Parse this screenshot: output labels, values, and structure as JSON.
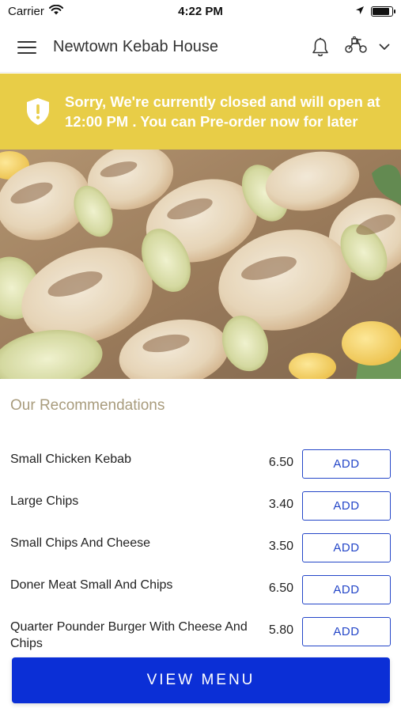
{
  "status_bar": {
    "carrier": "Carrier",
    "time": "4:22 PM",
    "battery_level": 0.9
  },
  "header": {
    "title": "Newtown Kebab House",
    "menu_icon": "hamburger-menu-icon",
    "notification_icon": "bell-icon",
    "delivery_icon": "scooter-icon",
    "dropdown_icon": "chevron-down-icon"
  },
  "banner": {
    "icon": "shield-alert-icon",
    "message": "Sorry, We're currently closed and will open at 12:00 PM . You can Pre-order now for later",
    "background": "#e8cd47"
  },
  "recommendations": {
    "title": "Our Recommendations",
    "add_label": "ADD",
    "items": [
      {
        "name": "Small Chicken Kebab",
        "price": "6.50"
      },
      {
        "name": "Large Chips",
        "price": "3.40"
      },
      {
        "name": "Small Chips And Cheese",
        "price": "3.50"
      },
      {
        "name": "Doner Meat Small And Chips",
        "price": "6.50"
      },
      {
        "name": "Quarter Pounder Burger With Cheese And Chips",
        "price": "5.80"
      }
    ]
  },
  "footer": {
    "view_menu_label": "VIEW MENU"
  },
  "colors": {
    "accent": "#0b2fd6",
    "add_button": "#2446c8",
    "section_title": "#a99c7d"
  }
}
